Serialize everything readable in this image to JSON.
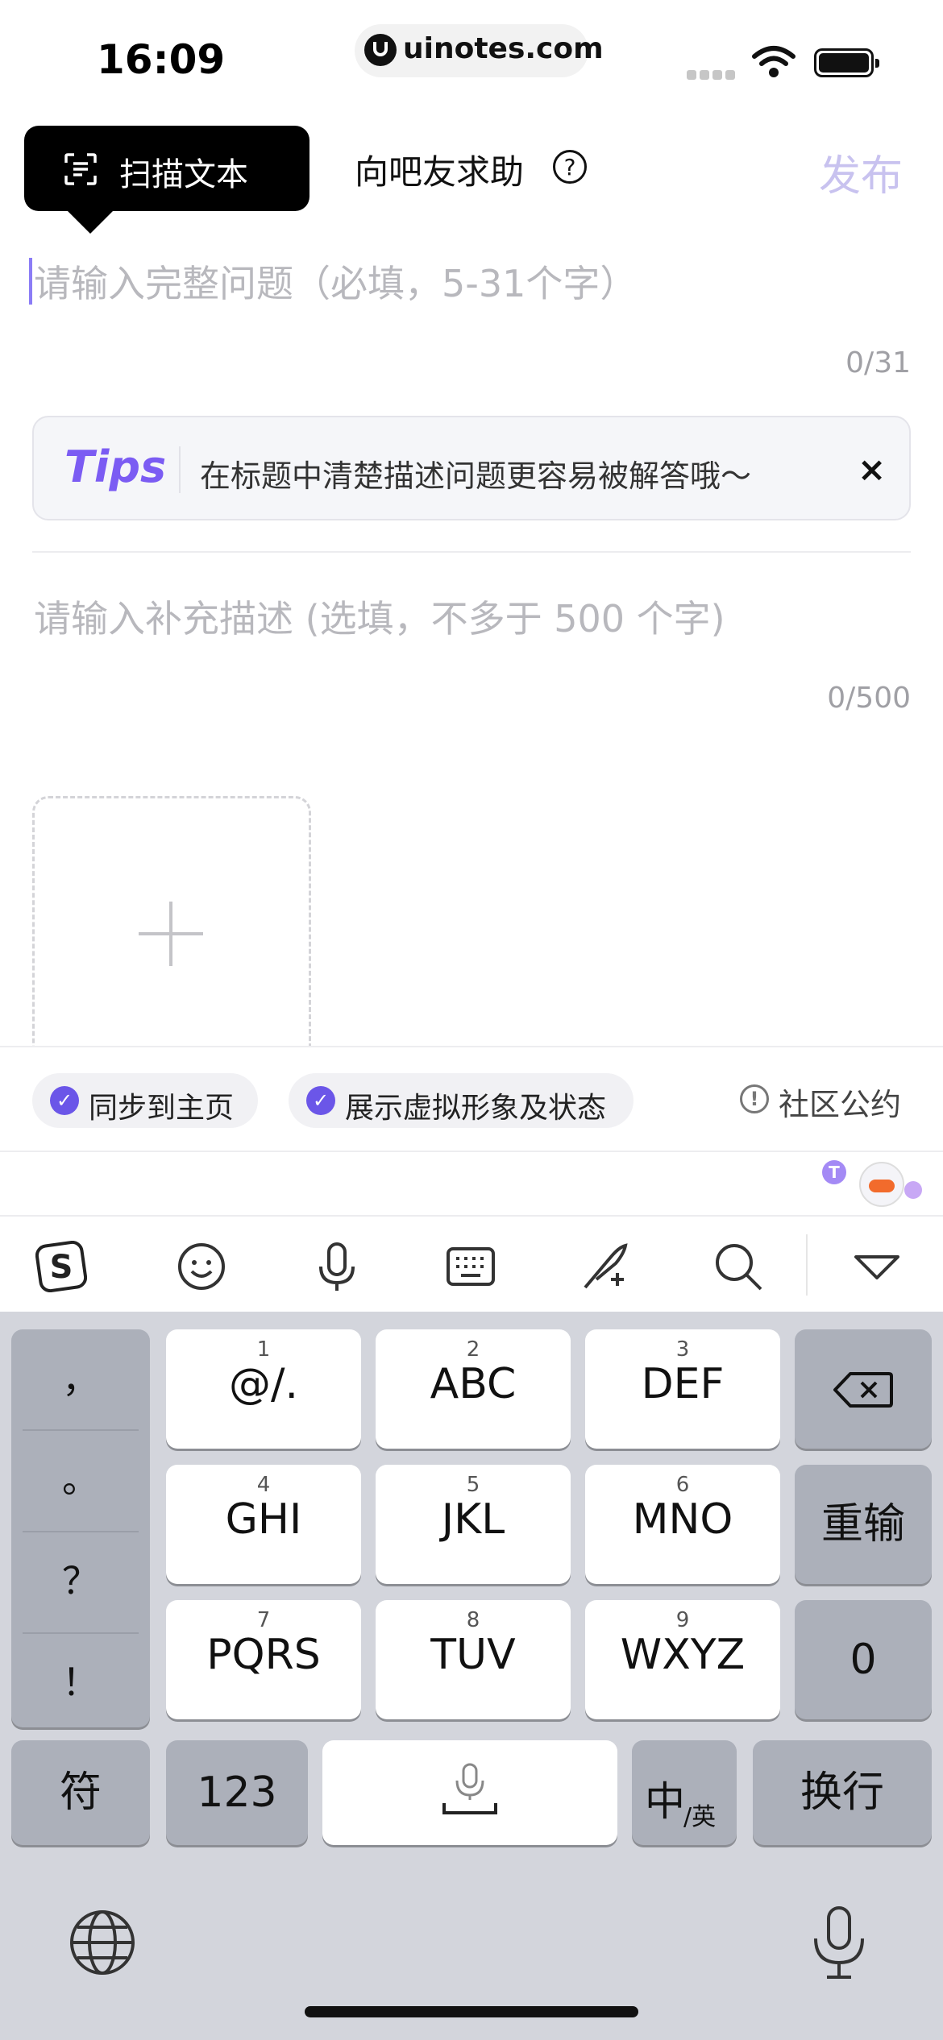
{
  "status_bar": {
    "time": "16:09",
    "url": "uinotes.com"
  },
  "header": {
    "scan_label": "扫描文本",
    "ask_label": "向吧友求助",
    "help_symbol": "?",
    "publish_label": "发布"
  },
  "title_field": {
    "placeholder": "请输入完整问题（必填，5-31个字）",
    "counter": "0/31"
  },
  "tips": {
    "logo": "Tips",
    "text": "在标题中清楚描述问题更容易被解答哦～",
    "close": "×"
  },
  "description_field": {
    "placeholder": "请输入补充描述 (选填，不多于 500 个字)",
    "counter": "0/500"
  },
  "options": {
    "sync_label": "同步到主页",
    "avatar_label": "展示虚拟形象及状态",
    "rules_label": "社区公约",
    "check": "✓"
  },
  "ime_toolbar": {
    "icons": [
      "sogou-logo-icon",
      "emoji-icon",
      "voice-icon",
      "keyboard-icon",
      "handwriting-icon",
      "search-icon",
      "collapse-icon"
    ]
  },
  "keyboard": {
    "punctuation": [
      "，",
      "。",
      "？",
      "！"
    ],
    "keys": [
      {
        "num": "1",
        "label": "@/."
      },
      {
        "num": "2",
        "label": "ABC"
      },
      {
        "num": "3",
        "label": "DEF"
      },
      {
        "num": "4",
        "label": "GHI"
      },
      {
        "num": "5",
        "label": "JKL"
      },
      {
        "num": "6",
        "label": "MNO"
      },
      {
        "num": "7",
        "label": "PQRS"
      },
      {
        "num": "8",
        "label": "TUV"
      },
      {
        "num": "9",
        "label": "WXYZ"
      }
    ],
    "retype": "重输",
    "zero": "0",
    "symbols": "符",
    "numbers": "123",
    "lang_main": "中",
    "lang_alt": "/英",
    "enter": "换行"
  },
  "colors": {
    "accent": "#6b56e8",
    "publish_disabled": "#c8c2ef"
  }
}
